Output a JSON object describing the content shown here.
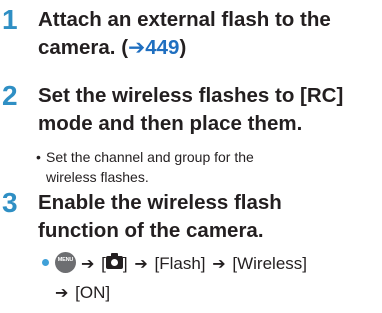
{
  "steps": [
    {
      "number": "1",
      "title_line1": "Attach an external flash to the",
      "title_line2_prefix": "camera. (",
      "ref_arrow": "➔",
      "ref_page": "449",
      "title_line2_suffix": ")"
    },
    {
      "number": "2",
      "title_line1": "Set the wireless flashes to [RC]",
      "title_line2": "mode and then place them.",
      "note_bullet": "•",
      "note_line1": "Set the channel and group for the",
      "note_line2": "wireless flashes."
    },
    {
      "number": "3",
      "title_line1": "Enable the wireless flash",
      "title_line2": "function of the camera.",
      "menu": {
        "button_text_top": "MENU",
        "button_text_bottom": "/SET",
        "arrow": "➔",
        "open_bracket": "[",
        "close_bracket": "]",
        "item_flash": "[Flash]",
        "item_wireless": "[Wireless]",
        "item_on": "[ON]"
      }
    }
  ],
  "colors": {
    "step_number": "#2f8fc4",
    "link": "#1f6fc0",
    "bullet": "#3fa0d8",
    "menu_button": "#6d6e71"
  }
}
